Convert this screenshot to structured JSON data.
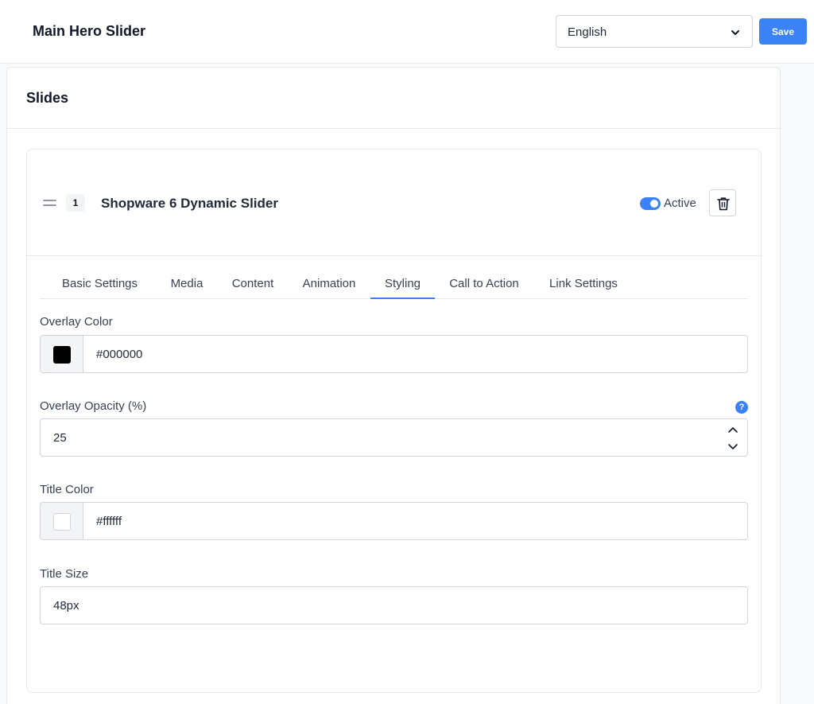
{
  "header": {
    "title": "Main Hero Slider",
    "language": {
      "selected": "English"
    },
    "save_label": "Save"
  },
  "panel": {
    "title": "Slides"
  },
  "slide": {
    "number": "1",
    "name": "Shopware 6 Dynamic Slider",
    "active": true,
    "active_label": "Active"
  },
  "tabs": [
    {
      "label": "Basic Settings",
      "active": false
    },
    {
      "label": "Media",
      "active": false
    },
    {
      "label": "Content",
      "active": false
    },
    {
      "label": "Animation",
      "active": false
    },
    {
      "label": "Styling",
      "active": true
    },
    {
      "label": "Call to Action",
      "active": false
    },
    {
      "label": "Link Settings",
      "active": false
    }
  ],
  "fields": {
    "overlay_color": {
      "label": "Overlay Color",
      "value": "#000000"
    },
    "overlay_opacity": {
      "label": "Overlay Opacity (%)",
      "value": "25",
      "help": "?"
    },
    "title_color": {
      "label": "Title Color",
      "value": "#ffffff"
    },
    "title_size": {
      "label": "Title Size",
      "value": "48px"
    }
  },
  "colors": {
    "accent": "#3b82f6",
    "overlay_swatch": "#000000",
    "title_swatch": "#ffffff"
  },
  "icons": {
    "language_chevron": "chevron-down-icon",
    "drag": "drag-handle-icon",
    "delete": "trash-icon",
    "help": "help-icon",
    "stepper_up": "chevron-up-icon",
    "stepper_down": "chevron-down-icon"
  }
}
